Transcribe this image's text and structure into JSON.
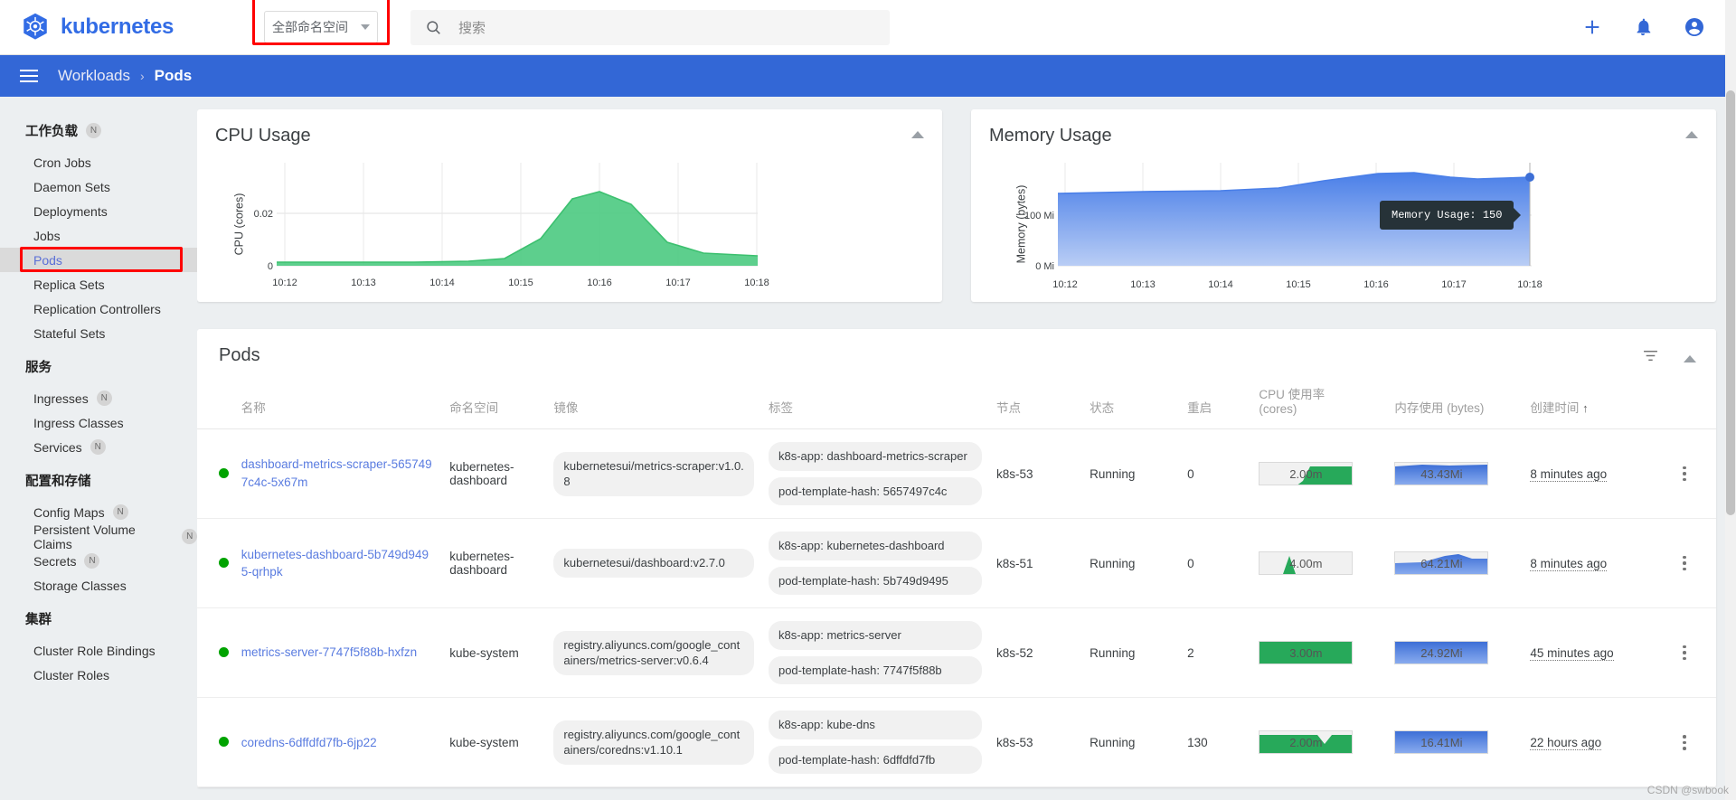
{
  "topbar": {
    "brand": "kubernetes",
    "namespace_selected": "全部命名空间",
    "search_placeholder": "搜索",
    "icons": {
      "search": "search-icon",
      "add": "plus-icon",
      "notify": "bell-icon",
      "account": "account-circle-icon"
    }
  },
  "breadcrumb": {
    "parent": "Workloads",
    "separator": "›",
    "current": "Pods"
  },
  "sidebar": {
    "groups": [
      {
        "title": "工作负载",
        "badge": "N",
        "items": [
          {
            "label": "Cron Jobs",
            "badge": "",
            "active": false
          },
          {
            "label": "Daemon Sets",
            "badge": "",
            "active": false
          },
          {
            "label": "Deployments",
            "badge": "",
            "active": false
          },
          {
            "label": "Jobs",
            "badge": "",
            "active": false
          },
          {
            "label": "Pods",
            "badge": "",
            "active": true
          },
          {
            "label": "Replica Sets",
            "badge": "",
            "active": false
          },
          {
            "label": "Replication Controllers",
            "badge": "",
            "active": false
          },
          {
            "label": "Stateful Sets",
            "badge": "",
            "active": false
          }
        ]
      },
      {
        "title": "服务",
        "badge": "",
        "items": [
          {
            "label": "Ingresses",
            "badge": "N",
            "active": false
          },
          {
            "label": "Ingress Classes",
            "badge": "",
            "active": false
          },
          {
            "label": "Services",
            "badge": "N",
            "active": false
          }
        ]
      },
      {
        "title": "配置和存储",
        "badge": "",
        "items": [
          {
            "label": "Config Maps",
            "badge": "N",
            "active": false
          },
          {
            "label": "Persistent Volume Claims",
            "badge": "N",
            "active": false
          },
          {
            "label": "Secrets",
            "badge": "N",
            "active": false
          },
          {
            "label": "Storage Classes",
            "badge": "",
            "active": false
          }
        ]
      },
      {
        "title": "集群",
        "badge": "",
        "items": [
          {
            "label": "Cluster Role Bindings",
            "badge": "",
            "active": false
          },
          {
            "label": "Cluster Roles",
            "badge": "",
            "active": false
          }
        ]
      }
    ]
  },
  "chart_data": [
    {
      "type": "area",
      "title": "CPU Usage",
      "ylabel": "CPU (cores)",
      "xlabel": "",
      "x": [
        "10:12",
        "10:13",
        "10:14",
        "10:15",
        "10:16",
        "10:17",
        "10:18"
      ],
      "ytick_labels": [
        "0.02",
        "0"
      ],
      "ylim": [
        0,
        0.027
      ],
      "values": [
        0.0015,
        0.0015,
        0.0015,
        0.0018,
        0.0185,
        0.0055,
        0.0042
      ],
      "series": [
        {
          "name": "CPU Usage",
          "values": [
            0.0015,
            0.0015,
            0.0015,
            0.0016,
            0.002,
            0.006,
            0.018,
            0.0235,
            0.0185,
            0.009,
            0.0055,
            0.0048,
            0.0045
          ],
          "color": "#42c97b"
        }
      ],
      "grid": true,
      "legend": false
    },
    {
      "type": "area",
      "title": "Memory Usage",
      "ylabel": "Memory (bytes)",
      "xlabel": "",
      "x": [
        "10:12",
        "10:13",
        "10:14",
        "10:15",
        "10:16",
        "10:17",
        "10:18"
      ],
      "ytick_labels": [
        "100 Mi",
        "0 Mi"
      ],
      "ylim": [
        0,
        190
      ],
      "values": [
        140,
        141,
        143,
        150,
        162,
        158,
        155
      ],
      "series": [
        {
          "name": "Memory Usage",
          "values": [
            138,
            139,
            140,
            141,
            143,
            148,
            157,
            163,
            164,
            161,
            156,
            156,
            157
          ],
          "color": "#4d7fe8"
        }
      ],
      "grid": true,
      "legend": false,
      "annotation": {
        "text": "Memory Usage: 150",
        "point_index": 12
      }
    }
  ],
  "pods": {
    "title": "Pods",
    "columns": [
      "",
      "名称",
      "命名空间",
      "镜像",
      "标签",
      "节点",
      "状态",
      "重启",
      "CPU 使用率 (cores)",
      "内存使用 (bytes)",
      "创建时间",
      ""
    ],
    "cpu_col_line1": "CPU 使用率",
    "cpu_col_line2": "(cores)",
    "sort_indicator": "↑",
    "rows": [
      {
        "name": "dashboard-metrics-scraper-5657497c4c-5x67m",
        "namespace": "kubernetes-dashboard",
        "image": "kubernetesui/metrics-scraper:v1.0.8",
        "labels": [
          "k8s-app: dashboard-metrics-scraper",
          "pod-template-hash: 5657497c4c"
        ],
        "node": "k8s-53",
        "status": "Running",
        "restarts": "0",
        "cpu": "2.00m",
        "memory": "43.43Mi",
        "age": "8 minutes ago"
      },
      {
        "name": "kubernetes-dashboard-5b749d9495-qrhpk",
        "namespace": "kubernetes-dashboard",
        "image": "kubernetesui/dashboard:v2.7.0",
        "labels": [
          "k8s-app: kubernetes-dashboard",
          "pod-template-hash: 5b749d9495"
        ],
        "node": "k8s-51",
        "status": "Running",
        "restarts": "0",
        "cpu": "4.00m",
        "memory": "64.21Mi",
        "age": "8 minutes ago"
      },
      {
        "name": "metrics-server-7747f5f88b-hxfzn",
        "namespace": "kube-system",
        "image": "registry.aliyuncs.com/google_containers/metrics-server:v0.6.4",
        "labels": [
          "k8s-app: metrics-server",
          "pod-template-hash: 7747f5f88b"
        ],
        "node": "k8s-52",
        "status": "Running",
        "restarts": "2",
        "cpu": "3.00m",
        "memory": "24.92Mi",
        "age": "45 minutes ago"
      },
      {
        "name": "coredns-6dffdfd7fb-6jp22",
        "namespace": "kube-system",
        "image": "registry.aliyuncs.com/google_containers/coredns:v1.10.1",
        "labels": [
          "k8s-app: kube-dns",
          "pod-template-hash: 6dffdfd7fb"
        ],
        "node": "k8s-53",
        "status": "Running",
        "restarts": "130",
        "cpu": "2.00m",
        "memory": "16.41Mi",
        "age": "22 hours ago"
      }
    ]
  },
  "watermark": "CSDN @swbook",
  "colors": {
    "brand_blue": "#326ce5",
    "bar_blue": "#3367d6",
    "cpu_green": "#42c97b",
    "mem_blue": "#4d7fe8",
    "status_green": "#00a300",
    "link_blue": "#5a7ce0",
    "highlight_red": "#ff0000"
  }
}
